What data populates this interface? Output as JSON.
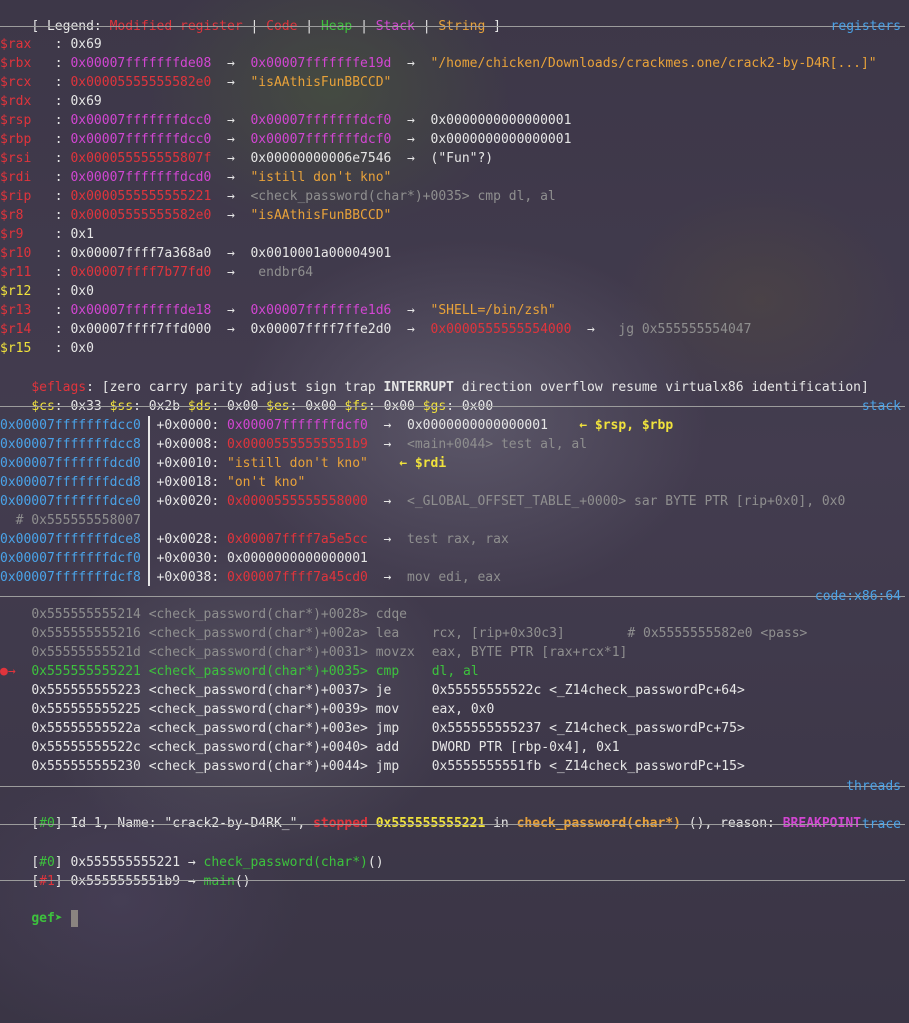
{
  "legend": {
    "open": "[ Legend: ",
    "modified": "Modified register",
    "code": "Code",
    "heap": "Heap",
    "stack": "Stack",
    "string": "String",
    "sep": " | ",
    "close": " ]"
  },
  "sections": {
    "registers": "registers",
    "stack": "stack",
    "code": "code:x86:64",
    "threads": "threads",
    "trace": "trace"
  },
  "registers": [
    {
      "name": "$rax",
      "val": "0x69"
    },
    {
      "name": "$rbx",
      "val": "0x00007fffffffde08",
      "a1": "0x00007fffffffe19d",
      "a2": "\"/home/chicken/Downloads/crackmes.one/crack2-by-D4R[...]\""
    },
    {
      "name": "$rcx",
      "val": "0x00005555555582e0",
      "a1": "\"isAAthisFunBBCCD\""
    },
    {
      "name": "$rdx",
      "val": "0x69"
    },
    {
      "name": "$rsp",
      "val": "0x00007fffffffdcc0",
      "a1": "0x00007fffffffdcf0",
      "a2": "0x0000000000000001"
    },
    {
      "name": "$rbp",
      "val": "0x00007fffffffdcc0",
      "a1": "0x00007fffffffdcf0",
      "a2": "0x0000000000000001"
    },
    {
      "name": "$rsi",
      "val": "0x000055555555807f",
      "a1": "0x00000000006e7546",
      "a2": "(\"Fun\"?)"
    },
    {
      "name": "$rdi",
      "val": "0x00007fffffffdcd0",
      "a1": "\"istill don't kno\""
    },
    {
      "name": "$rip",
      "val": "0x0000555555555221",
      "a1": "<check_password(char*)+0035> cmp dl, al"
    },
    {
      "name": "$r8",
      "val": "0x00005555555582e0",
      "a1": "\"isAAthisFunBBCCD\""
    },
    {
      "name": "$r9",
      "val": "0x1"
    },
    {
      "name": "$r10",
      "val": "0x00007ffff7a368a0",
      "a1": "0x0010001a00004901"
    },
    {
      "name": "$r11",
      "val": "0x00007ffff7b77fd0",
      "a1": " endbr64"
    },
    {
      "name": "$r12",
      "val": "0x0"
    },
    {
      "name": "$r13",
      "val": "0x00007fffffffde18",
      "a1": "0x00007fffffffe1d6",
      "a2": "\"SHELL=/bin/zsh\""
    },
    {
      "name": "$r14",
      "val": "0x00007ffff7ffd000",
      "a1": "0x00007ffff7ffe2d0",
      "a2": "0x0000555555554000",
      "a3": " jg 0x555555554047"
    },
    {
      "name": "$r15",
      "val": "0x0"
    }
  ],
  "eflags": {
    "name": "$eflags",
    "pre": ": [zero carry parity adjust sign trap ",
    "bold": "INTERRUPT",
    "post": " direction overflow resume virtualx86 identification]"
  },
  "segments": [
    {
      "name": "$cs",
      "val": ": 0x33 "
    },
    {
      "name": "$ss",
      "val": ": 0x2b "
    },
    {
      "name": "$ds",
      "val": ": 0x00 "
    },
    {
      "name": "$es",
      "val": ": 0x00 "
    },
    {
      "name": "$fs",
      "val": ": 0x00 "
    },
    {
      "name": "$gs",
      "val": ": 0x00"
    }
  ],
  "stack": [
    {
      "addr": "0x00007fffffffdcc0",
      "off": "+0x0000:",
      "val": "0x00007fffffffdcf0",
      "a1": "0x0000000000000001",
      "tag": "← $rsp, $rbp"
    },
    {
      "addr": "0x00007fffffffdcc8",
      "off": "+0x0008:",
      "val": "0x00005555555551b9",
      "a1": "<main+0044> test al, al"
    },
    {
      "addr": "0x00007fffffffdcd0",
      "off": "+0x0010:",
      "val": "\"istill don't kno\"",
      "tag": "← $rdi"
    },
    {
      "addr": "0x00007fffffffdcd8",
      "off": "+0x0018:",
      "val": "\"on't kno\""
    },
    {
      "addr": "0x00007fffffffdce0",
      "off": "+0x0020:",
      "val": "0x0000555555558000",
      "a1": "<_GLOBAL_OFFSET_TABLE_+0000> sar BYTE PTR [rip+0x0], 0x0",
      "wrap": "  # 0x555555558007"
    },
    {
      "addr": "0x00007fffffffdce8",
      "off": "+0x0028:",
      "val": "0x00007ffff7a5e5cc",
      "a1": "test rax, rax"
    },
    {
      "addr": "0x00007fffffffdcf0",
      "off": "+0x0030:",
      "val": "0x0000000000000001"
    },
    {
      "addr": "0x00007fffffffdcf8",
      "off": "+0x0038:",
      "val": "0x00007ffff7a45cd0",
      "a1": "mov edi, eax"
    }
  ],
  "code": [
    {
      "addr": "0x555555555214",
      "sym": "<check_password(char*)+0028>",
      "mn": "cdqe",
      "op": "",
      "state": "past"
    },
    {
      "addr": "0x555555555216",
      "sym": "<check_password(char*)+002a>",
      "mn": "lea",
      "op": "rcx, [rip+0x30c3]        # 0x5555555582e0 <pass>",
      "state": "past"
    },
    {
      "addr": "0x55555555521d",
      "sym": "<check_password(char*)+0031>",
      "mn": "movzx",
      "op": "eax, BYTE PTR [rax+rcx*1]",
      "state": "past"
    },
    {
      "addr": "0x555555555221",
      "sym": "<check_password(char*)+0035>",
      "mn": "cmp",
      "op": "dl, al",
      "state": "current"
    },
    {
      "addr": "0x555555555223",
      "sym": "<check_password(char*)+0037>",
      "mn": "je",
      "op": "0x55555555522c <_Z14check_passwordPc+64>",
      "state": "next"
    },
    {
      "addr": "0x555555555225",
      "sym": "<check_password(char*)+0039>",
      "mn": "mov",
      "op": "eax, 0x0",
      "state": "next"
    },
    {
      "addr": "0x55555555522a",
      "sym": "<check_password(char*)+003e>",
      "mn": "jmp",
      "op": "0x555555555237 <_Z14check_passwordPc+75>",
      "state": "next"
    },
    {
      "addr": "0x55555555522c",
      "sym": "<check_password(char*)+0040>",
      "mn": "add",
      "op": "DWORD PTR [rbp-0x4], 0x1",
      "state": "next"
    },
    {
      "addr": "0x555555555230",
      "sym": "<check_password(char*)+0044>",
      "mn": "jmp",
      "op": "0x5555555551fb <_Z14check_passwordPc+15>",
      "state": "next"
    }
  ],
  "threads": {
    "idx": "[#0]",
    "pre": " Id 1, Name: \"crack2-by-D4RK_\", ",
    "stopped": "stopped",
    "addr": "0x555555555221",
    "in": " in ",
    "func": "check_password(char*)",
    "mid": " (), reason: ",
    "reason": "BREAKPOINT"
  },
  "trace": [
    {
      "idx": "[#0]",
      "addr": " 0x555555555221 → ",
      "func": "check_password(char*)",
      "tail": "()"
    },
    {
      "idx": "[#1]",
      "addr": " 0x5555555551b9 → ",
      "func": "main",
      "tail": "()"
    }
  ],
  "prompt": "gef➤"
}
